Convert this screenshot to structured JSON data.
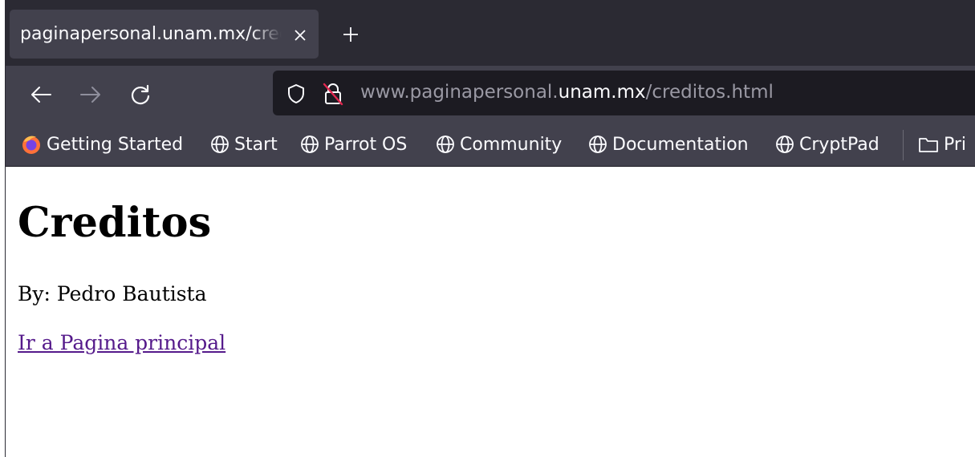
{
  "browser": {
    "tab": {
      "title": "paginapersonal.unam.mx/creditos.html"
    },
    "url": {
      "prefix": "www.paginapersonal.",
      "domain": "unam.mx",
      "path": "/creditos.html"
    },
    "bookmarks": [
      {
        "label": "Getting Started",
        "icon": "firefox-logo-icon"
      },
      {
        "label": "Start",
        "icon": "globe-icon"
      },
      {
        "label": "Parrot OS",
        "icon": "globe-icon"
      },
      {
        "label": "Community",
        "icon": "globe-icon"
      },
      {
        "label": "Documentation",
        "icon": "globe-icon"
      },
      {
        "label": "CryptPad",
        "icon": "globe-icon"
      },
      {
        "label": "Pri",
        "icon": "folder-icon"
      }
    ],
    "colors": {
      "chrome_dark": "#2b2a33",
      "chrome": "#42414d",
      "urlbar": "#1c1b22"
    }
  },
  "page": {
    "heading": "Creditos",
    "byline": "By: Pedro Bautista",
    "link_text": "Ir a Pagina principal",
    "link_color": "#551a8b"
  }
}
